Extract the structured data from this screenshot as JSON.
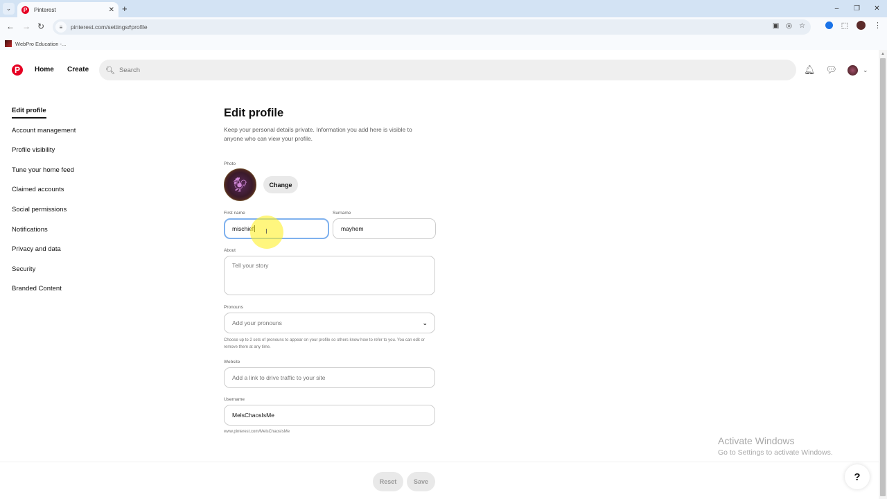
{
  "browser": {
    "tab_title": "Pinterest",
    "url": "pinterest.com/settings#profile",
    "bookmark": "WebPro Education -..."
  },
  "header": {
    "nav": [
      "Home",
      "Create"
    ],
    "search_placeholder": "Search"
  },
  "sidebar": {
    "items": [
      {
        "label": "Edit profile",
        "active": true
      },
      {
        "label": "Account management"
      },
      {
        "label": "Profile visibility"
      },
      {
        "label": "Tune your home feed"
      },
      {
        "label": "Claimed accounts"
      },
      {
        "label": "Social permissions"
      },
      {
        "label": "Notifications"
      },
      {
        "label": "Privacy and data"
      },
      {
        "label": "Security"
      },
      {
        "label": "Branded Content"
      }
    ]
  },
  "form": {
    "title": "Edit profile",
    "description": "Keep your personal details private. Information you add here is visible to anyone who can view your profile.",
    "photo_label": "Photo",
    "change_label": "Change",
    "first_name_label": "First name",
    "first_name_value": "mischief",
    "surname_label": "Surname",
    "surname_value": "mayhem",
    "about_label": "About",
    "about_placeholder": "Tell your story",
    "pronouns_label": "Pronouns",
    "pronouns_placeholder": "Add your pronouns",
    "pronouns_help": "Choose up to 2 sets of pronouns to appear on your profile so others know how to refer to you. You can edit or remove them at any time.",
    "website_label": "Website",
    "website_placeholder": "Add a link to drive traffic to your site",
    "username_label": "Username",
    "username_value": "MelsChaosIsMe",
    "profile_url": "www.pinterest.com/MelsChaosIsMe"
  },
  "footer": {
    "reset_label": "Reset",
    "save_label": "Save",
    "help_label": "?"
  },
  "watermark": {
    "line1": "Activate Windows",
    "line2": "Go to Settings to activate Windows."
  },
  "colors": {
    "brand": "#e60023",
    "focus_ring": "#7fb1ee"
  }
}
